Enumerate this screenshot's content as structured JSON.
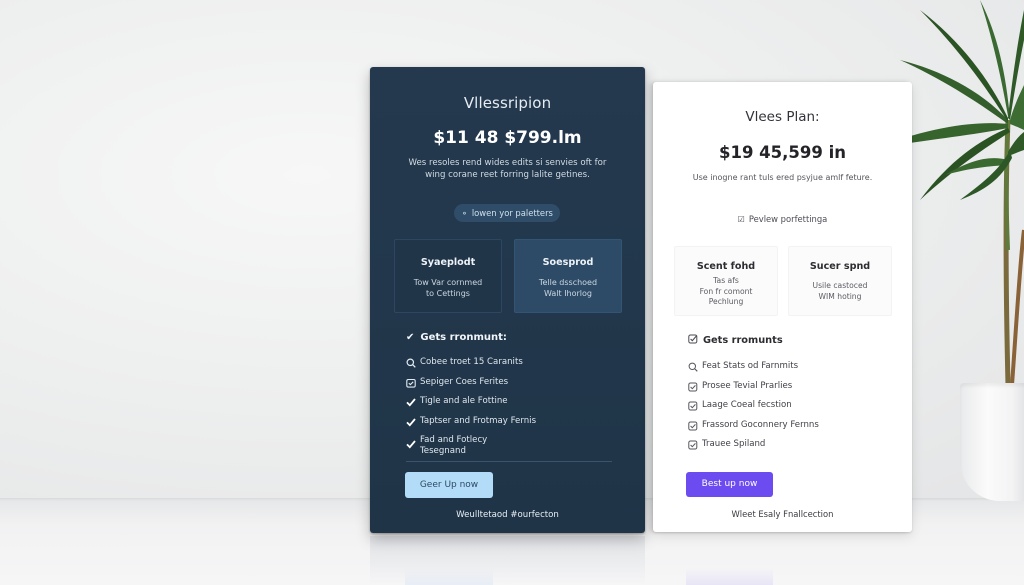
{
  "scene": {
    "description": "Photo of two pricing cards standing on a white surface with a potted plant",
    "colors": {
      "dark_card_bg": "#22374b",
      "dark_cta_bg": "#b3dcf8",
      "light_card_bg": "#ffffff",
      "light_cta_bg": "#6c4cf0",
      "plant_green": "#2f5a2a"
    }
  },
  "dark_card": {
    "title": "Vllessripion",
    "price": "$11 48 $799.lm",
    "description": "Wes resoles rend wides edits si senvies oft for wing corane reet forring lalite getines.",
    "pill": {
      "icon": "badge-icon",
      "label": "lowen yor paletters"
    },
    "options": [
      {
        "title": "Syaeplodt",
        "subtitle": "Tow Var cornmed\nto Cettings"
      },
      {
        "title": "Soesprod",
        "subtitle": "Telle dsschoed\nWalt Ihorlog"
      }
    ],
    "features_heading": "Gets rronmunt:",
    "features": [
      {
        "icon": "search-icon",
        "label": "Cobee troet 15 Caranits"
      },
      {
        "icon": "calendar-icon",
        "label": "Sepiger Coes Ferites"
      },
      {
        "icon": "check-icon",
        "label": "Tigle and ale Fottine"
      },
      {
        "icon": "check-icon",
        "label": "Taptser and Frotmay Fernis"
      },
      {
        "icon": "check-icon",
        "label": "Fad and Fotlecy Tesegnand"
      }
    ],
    "cta_label": "Geer Up now",
    "footer": "Weulltetaod #ourfecton"
  },
  "light_card": {
    "title": "Vlees Plan:",
    "price": "$19 45,599 in",
    "description": "Use inogne rant tuls ered psyjue amlf feture.",
    "link": {
      "icon": "checkbox-icon",
      "label": "Pevlew porfettinga"
    },
    "options": [
      {
        "title": "Scent fohd",
        "subtitle": "Tas afs\nFon fr comont\nPechlung"
      },
      {
        "title": "Sucer spnd",
        "subtitle": "Usile castoced\nWIM hoting"
      }
    ],
    "features_heading": "Gets rromunts",
    "features": [
      {
        "icon": "search-icon",
        "label": "Feat Stats od Farnmits"
      },
      {
        "icon": "checkbox-icon",
        "label": "Prosee Tevial Prarlies"
      },
      {
        "icon": "checkbox-icon",
        "label": "Laage Coeal fecstion"
      },
      {
        "icon": "checkbox-icon",
        "label": "Frassord Goconnery Fernns"
      },
      {
        "icon": "checkbox-icon",
        "label": "Trauee Spiland"
      }
    ],
    "cta_label": "Best up now",
    "footer": "Wleet Esaly Fnallcection"
  }
}
